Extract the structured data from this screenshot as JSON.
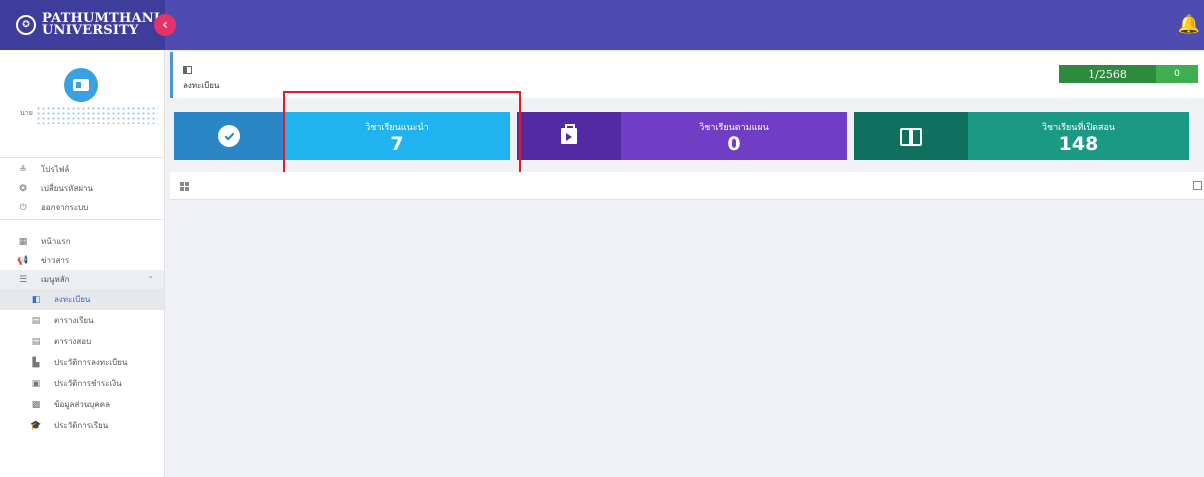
{
  "header": {
    "university_name": "PATHUMTHANI UNIVERSITY",
    "collapse_icon": "chevron-left-icon",
    "bell_icon": "bell-icon"
  },
  "profile": {
    "prefix": "นาย",
    "avatar_icon": "id-card-icon"
  },
  "account_menu": [
    {
      "label": "โปรไฟล์",
      "icon": "user-icon"
    },
    {
      "label": "เปลี่ยนรหัสผ่าน",
      "icon": "key-icon"
    },
    {
      "label": "ออกจากระบบ",
      "icon": "power-icon"
    }
  ],
  "main_menu": [
    {
      "label": "หน้าแรก",
      "icon": "dashboard-icon"
    },
    {
      "label": "ข่าวสาร",
      "icon": "megaphone-icon"
    },
    {
      "label": "เมนูหลัก",
      "icon": "menu-icon"
    }
  ],
  "sub_menu": [
    {
      "label": "ลงทะเบียน",
      "icon": "register-icon"
    },
    {
      "label": "ตารางเรียน",
      "icon": "calendar-icon"
    },
    {
      "label": "ตารางสอบ",
      "icon": "calendar-icon"
    },
    {
      "label": "ประวัติการลงทะเบียน",
      "icon": "history-icon"
    },
    {
      "label": "ประวัติการชำระเงิน",
      "icon": "payment-icon"
    },
    {
      "label": "ข้อมูลส่วนบุคคล",
      "icon": "contact-icon"
    },
    {
      "label": "ประวัติการเรียน",
      "icon": "graduation-cap-icon"
    }
  ],
  "page": {
    "title": "ลงทะเบียน",
    "term": "1/2568",
    "term_count": "0"
  },
  "cards": [
    {
      "label": "วิชาเรียนแนะนำ",
      "value": "7",
      "icon": "check-circle-icon",
      "color": "#20b3ef"
    },
    {
      "label": "วิชาเรียนตามแผน",
      "value": "0",
      "icon": "briefcase-icon",
      "color": "#6f3ec4"
    },
    {
      "label": "วิชาเรียนที่เปิดสอน",
      "value": "148",
      "icon": "book-open-icon",
      "color": "#1a9a85"
    }
  ],
  "colors": {
    "header": "#4e4cb0",
    "highlight": "#e31b23",
    "term_badge": "#2e8b3e"
  }
}
